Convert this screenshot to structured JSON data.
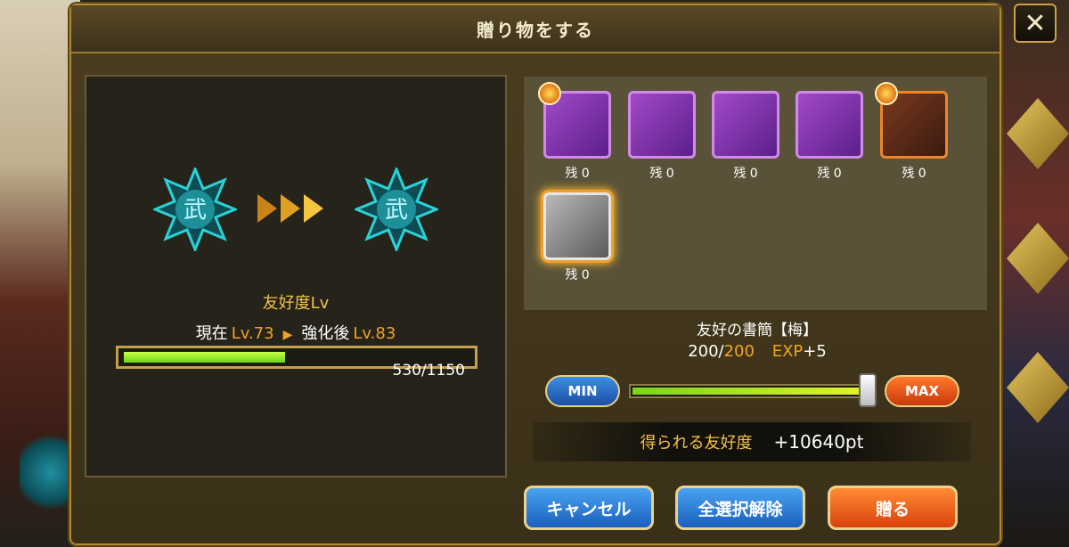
{
  "dialog": {
    "title": "贈り物をする",
    "close_label": "✕"
  },
  "friendship": {
    "label": "友好度Lv",
    "current_prefix": "現在",
    "current_level": "Lv.73",
    "after_prefix": "強化後",
    "after_level": "Lv.83",
    "exp_text": "530/1150",
    "exp_ratio": 0.46,
    "emblem_char": "武"
  },
  "items": [
    {
      "name": "gift-scroll-bundle",
      "count": "残 0",
      "frame": "purple",
      "badge": true
    },
    {
      "name": "golden-fish",
      "count": "残 0",
      "frame": "purple",
      "badge": false
    },
    {
      "name": "omamori-charm",
      "count": "残 0",
      "frame": "purple",
      "badge": false
    },
    {
      "name": "flame-star",
      "count": "残 0",
      "frame": "purple",
      "badge": false
    },
    {
      "name": "samurai-portrait",
      "count": "残 0",
      "frame": "orange",
      "badge": true
    },
    {
      "name": "friendship-letter",
      "count": "残 0",
      "frame": "gray",
      "badge": false
    }
  ],
  "selection": {
    "name": "友好の書簡【梅】",
    "qty_current": "200/",
    "qty_max": "200",
    "exp_label": "EXP",
    "exp_gain": "+5"
  },
  "slider": {
    "min_label": "MIN",
    "max_label": "MAX",
    "fill_ratio": 1.0
  },
  "gain": {
    "label": "得られる友好度",
    "value": "+10640pt"
  },
  "buttons": {
    "cancel": "キャンセル",
    "deselect_all": "全選択解除",
    "gift": "贈る"
  },
  "colors": {
    "accent_gold": "#f0a520",
    "button_blue": "#1a5fbf",
    "button_orange": "#d8420c",
    "emblem_cyan": "#27d3d8"
  }
}
